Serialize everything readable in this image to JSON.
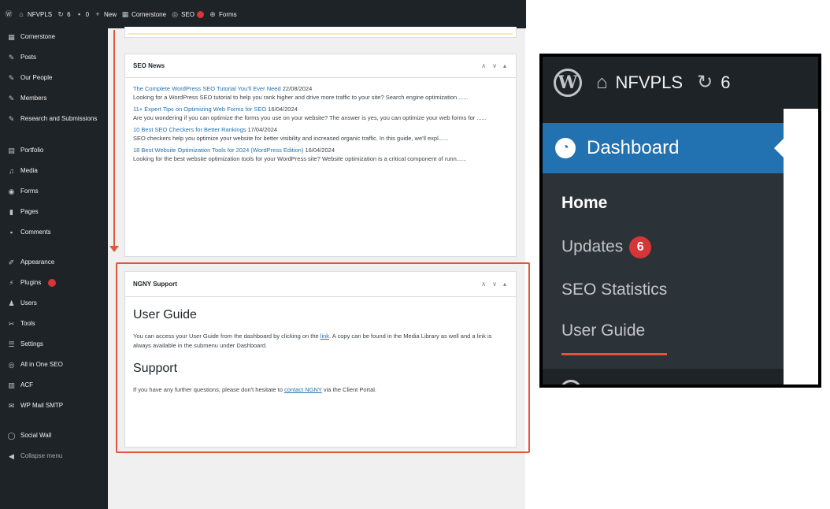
{
  "admin_bar": {
    "wp_logo": "wordpress-icon",
    "site_name": "NFVPLS",
    "updates_count": "6",
    "comments_count": "0",
    "new_label": "New",
    "cornerstone_label": "Cornerstone",
    "seo_label": "SEO",
    "forms_label": "Forms"
  },
  "sidebar": {
    "items": [
      {
        "label": "Cornerstone",
        "icon": "cornerstone-icon"
      },
      {
        "label": "Posts",
        "icon": "pin-icon"
      },
      {
        "label": "Our People",
        "icon": "pin-icon"
      },
      {
        "label": "Members",
        "icon": "pin-icon"
      },
      {
        "label": "Research and Submissions",
        "icon": "pin-icon"
      },
      {
        "label": "Portfolio",
        "icon": "portfolio-icon"
      },
      {
        "label": "Media",
        "icon": "media-icon"
      },
      {
        "label": "Forms",
        "icon": "forms-icon"
      },
      {
        "label": "Pages",
        "icon": "pages-icon"
      },
      {
        "label": "Comments",
        "icon": "comments-icon"
      },
      {
        "label": "Appearance",
        "icon": "appearance-icon"
      },
      {
        "label": "Plugins",
        "icon": "plugins-icon"
      },
      {
        "label": "Users",
        "icon": "users-icon"
      },
      {
        "label": "Tools",
        "icon": "tools-icon"
      },
      {
        "label": "Settings",
        "icon": "settings-icon"
      },
      {
        "label": "All in One SEO",
        "icon": "seo-icon"
      },
      {
        "label": "ACF",
        "icon": "acf-icon"
      },
      {
        "label": "WP Mail SMTP",
        "icon": "mail-icon"
      },
      {
        "label": "Social Wall",
        "icon": "social-wall-icon"
      },
      {
        "label": "Collapse menu",
        "icon": "collapse-icon"
      }
    ]
  },
  "seo_news": {
    "title": "SEO News",
    "items": [
      {
        "link": "The Complete WordPress SEO Tutorial You'll Ever Need",
        "date": "22/08/2024",
        "excerpt": "Looking for a WordPress SEO tutorial to help you rank higher and drive more traffic to your site? Search engine optimization ......"
      },
      {
        "link": "11+ Expert Tips on Optimizing Web Forms for SEO",
        "date": "16/04/2024",
        "excerpt": "Are you wondering if you can optimize the forms you use on your website? The answer is yes, you can optimize your web forms for ......"
      },
      {
        "link": "10 Best SEO Checkers for Better Rankings",
        "date": "17/04/2024",
        "excerpt": "SEO checkers help you optimize your website for better visibility and increased organic traffic. In this guide, we'll expl......"
      },
      {
        "link": "18 Best Website Optimization Tools for 2024 (WordPress Edition)",
        "date": "16/04/2024",
        "excerpt": "Looking for the best website optimization tools for your WordPress site? Website optimization is a critical component of runn......"
      }
    ]
  },
  "support_box": {
    "title": "NGNY Support",
    "guide_heading": "User Guide",
    "guide_text_before": "You can access your User Guide from the dashboard by clicking on the",
    "guide_link": "link",
    "guide_text_after": ". A copy can be found in the Media Library as well and a link is always available in the submenu under Dashboard.",
    "support_heading": "Support",
    "support_text_before": "If you have any further questions, please don't hesitate to",
    "support_link": "contact NGNY",
    "support_text_after": "via the Client Portal."
  },
  "zoom": {
    "site_name": "NFVPLS",
    "updates_count": "6",
    "dashboard_label": "Dashboard",
    "submenu": {
      "home": "Home",
      "updates": "Updates",
      "updates_badge": "6",
      "seo_statistics": "SEO Statistics",
      "user_guide": "User Guide"
    }
  },
  "colors": {
    "admin_dark": "#1d2327",
    "accent_blue": "#2271b1",
    "highlight_red": "#e3543e",
    "badge_red": "#d63638"
  }
}
